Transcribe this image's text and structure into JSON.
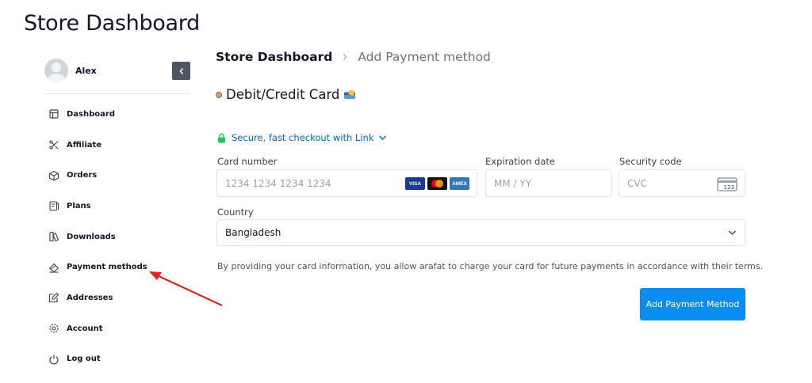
{
  "page": {
    "title": "Store Dashboard"
  },
  "user": {
    "name": "Alex"
  },
  "sidebar": {
    "items": [
      {
        "label": "Dashboard",
        "icon": "dashboard-icon"
      },
      {
        "label": "Affiliate",
        "icon": "affiliate-icon"
      },
      {
        "label": "Orders",
        "icon": "orders-box-icon"
      },
      {
        "label": "Plans",
        "icon": "plans-icon"
      },
      {
        "label": "Downloads",
        "icon": "downloads-icon"
      },
      {
        "label": "Payment methods",
        "icon": "payment-methods-icon"
      },
      {
        "label": "Addresses",
        "icon": "addresses-edit-icon"
      },
      {
        "label": "Account",
        "icon": "gear-icon"
      },
      {
        "label": "Log out",
        "icon": "power-icon"
      }
    ]
  },
  "breadcrumb": {
    "root": "Store Dashboard",
    "current": "Add Payment method"
  },
  "method": {
    "label": "Debit/Credit Card"
  },
  "link": {
    "text": "Secure, fast checkout with Link"
  },
  "form": {
    "card_number": {
      "label": "Card number",
      "placeholder": "1234 1234 1234 1234"
    },
    "expiration": {
      "label": "Expiration date",
      "placeholder": "MM / YY"
    },
    "security": {
      "label": "Security code",
      "placeholder": "CVC"
    },
    "country": {
      "label": "Country",
      "value": "Bangladesh"
    },
    "brands": [
      "VISA",
      "AMEX"
    ],
    "cvc_hint": "123",
    "terms": "By providing your card information, you allow arafat to charge your card for future payments in accordance with their terms.",
    "submit_label": "Add Payment Method"
  },
  "colors": {
    "primary": "#0a8cf0",
    "link": "#0a66c2",
    "annotation_arrow": "#e02424"
  }
}
